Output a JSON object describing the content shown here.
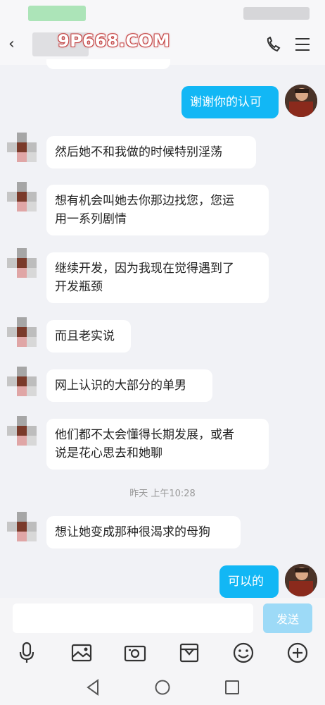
{
  "header": {
    "back_glyph": "‹",
    "watermark": "9P668.COM"
  },
  "messages": [
    {
      "side": "me",
      "text": "谢谢你的认可"
    },
    {
      "side": "them",
      "text": "然后她不和我做的时候特别淫荡"
    },
    {
      "side": "them",
      "line1": "想有机会叫她去你那边找您，您运",
      "line2": "用一系列剧情"
    },
    {
      "side": "them",
      "line1": "继续开发，因为我现在觉得遇到了",
      "line2": "开发瓶颈"
    },
    {
      "side": "them",
      "text": "而且老实说"
    },
    {
      "side": "them",
      "text": "网上认识的大部分的单男"
    },
    {
      "side": "them",
      "line1": "他们都不太会懂得长期发展，或者",
      "line2": "说是花心思去和她聊"
    },
    {
      "side": "them",
      "text": "想让她变成那种很渴求的母狗"
    },
    {
      "side": "me",
      "text": "可以的"
    }
  ],
  "timestamp": "昨天 上午10:28",
  "input": {
    "value": "",
    "send_label": "发送"
  },
  "toolbar": [
    "microphone-icon",
    "image-icon",
    "camera-icon",
    "gift-box-icon",
    "emoji-icon",
    "plus-icon"
  ],
  "colors": {
    "my_bubble": "#12b7f5",
    "their_bubble": "#ffffff",
    "send_button": "#9ddaf7",
    "background": "#f1f2f6"
  }
}
